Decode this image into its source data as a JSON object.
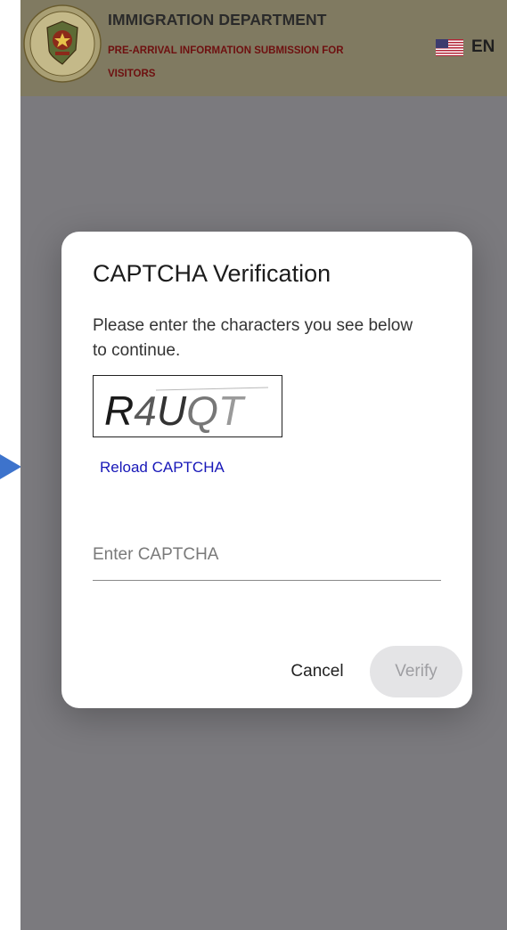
{
  "header": {
    "emblem_text": "QUẢN LÝ XUẤT NHẬP CẢNH · IMMIGRATION",
    "title": "IMMIGRATION DEPARTMENT",
    "subtitle": "PRE-ARRIVAL INFORMATION SUBMISSION FOR VISITORS",
    "language": "EN",
    "flag_icon": "us-flag-icon"
  },
  "dialog": {
    "title": "CAPTCHA Verification",
    "message": "Please enter the characters you see below to continue.",
    "captcha_text": "R4UQT",
    "reload_label": "Reload CAPTCHA",
    "input_placeholder": "Enter CAPTCHA",
    "input_value": "",
    "cancel_label": "Cancel",
    "verify_label": "Verify"
  },
  "colors": {
    "overlay": "#7b7a7e",
    "header_bg": "#807a61",
    "link": "#1717b8",
    "subtitle": "#6e1010",
    "arrow": "#3d73cc",
    "verify_disabled_bg": "#e4e4e6"
  }
}
